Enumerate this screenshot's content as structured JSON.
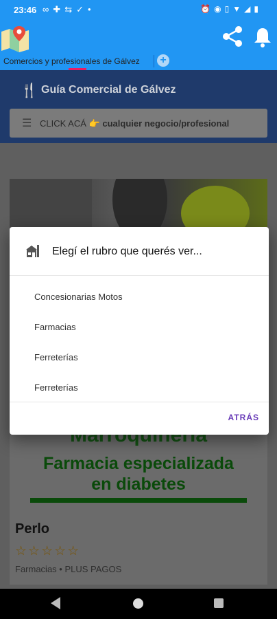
{
  "status_bar": {
    "time": "23:46",
    "left_icons": [
      "voicemail-icon",
      "puzzle-icon",
      "transfer-icon",
      "check-download-icon",
      "dot-icon"
    ],
    "right_icons": [
      "alarm-icon",
      "eye-icon",
      "vibrate-icon",
      "wifi-icon",
      "signal-4g-icon",
      "battery-icon"
    ]
  },
  "app_bar": {
    "tab_title": "Comercios y profesionales de Gálvez",
    "add_tab_symbol": "+",
    "icons": [
      "map-pin-icon",
      "share-icon",
      "bell-icon"
    ],
    "color": "#2196f3",
    "accent": "#e91e63"
  },
  "page": {
    "banner_title": "Guía Comercial de Gálvez",
    "search_prefix": "CLICK ACÁ",
    "search_emoji": "👉",
    "search_bold": "cualquier negocio/profesional",
    "card": {
      "marroquineria": "Marroquinería",
      "promo_line1": "Farmacia especializada",
      "promo_line2": "en diabetes",
      "name": "Perlo",
      "stars": "☆☆☆☆☆",
      "meta": "Farmacias • PLUS PAGOS"
    }
  },
  "dialog": {
    "title": "Elegí el rubro que querés ver...",
    "options": [
      "Concesionarias Motos",
      "Farmacias",
      "Ferreterías",
      "Ferreterías"
    ],
    "back_label": "ATRÁS",
    "accent": "#673ab7"
  },
  "nav_bar": {
    "icons": [
      "back-icon",
      "home-icon",
      "recents-icon"
    ]
  }
}
